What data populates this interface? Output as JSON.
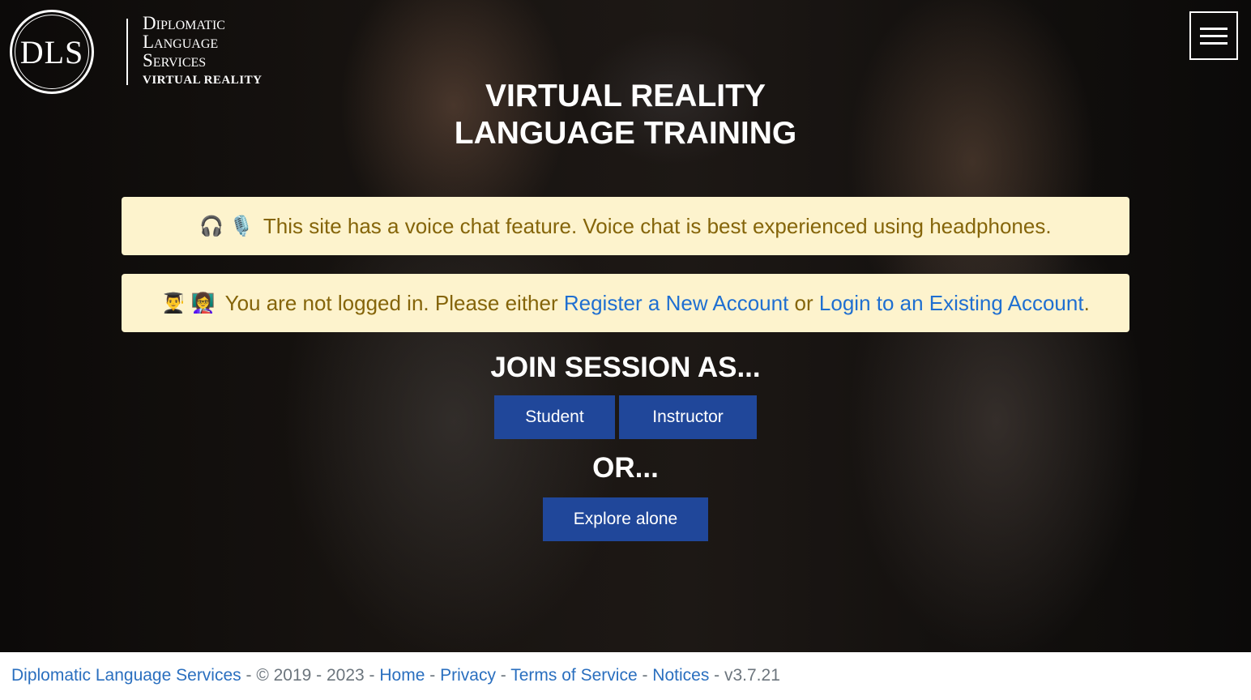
{
  "logo": {
    "mark": "DLS",
    "line1": "Diplomatic",
    "line2": "Language",
    "line3": "Services",
    "subtitle": "VIRTUAL REALITY"
  },
  "header": {
    "menu_icon": "hamburger-menu-icon"
  },
  "hero": {
    "title_line1": "VIRTUAL REALITY",
    "title_line2": "LANGUAGE TRAINING"
  },
  "alerts": {
    "voice": {
      "icons": [
        "headphone-icon",
        "microphone-icon"
      ],
      "icon_glyphs": "🎧 🎙️",
      "text": "This site has a voice chat feature. Voice chat is best experienced using headphones."
    },
    "login": {
      "icons": [
        "student-icon",
        "teacher-icon"
      ],
      "icon_glyphs": "👨‍🎓 👩‍🏫",
      "prefix": "You are not logged in. Please either ",
      "register_link": "Register a New Account",
      "middle": " or ",
      "login_link": "Login to an Existing Account",
      "suffix": "."
    }
  },
  "join": {
    "heading": "JOIN SESSION AS...",
    "student_label": "Student",
    "instructor_label": "Instructor",
    "or_label": "OR...",
    "explore_label": "Explore alone"
  },
  "footer": {
    "company_link": "Diplomatic Language Services",
    "copyright": " - © 2019 - 2023 - ",
    "home_link": "Home",
    "sep1": " - ",
    "privacy_link": "Privacy",
    "sep2": " - ",
    "terms_link": "Terms of Service",
    "sep3": " - ",
    "notices_link": "Notices",
    "version": " - v3.7.21"
  },
  "colors": {
    "alert_bg": "#fdf3cd",
    "alert_text": "#85650a",
    "link": "#1f6fd1",
    "button": "#20479a"
  }
}
